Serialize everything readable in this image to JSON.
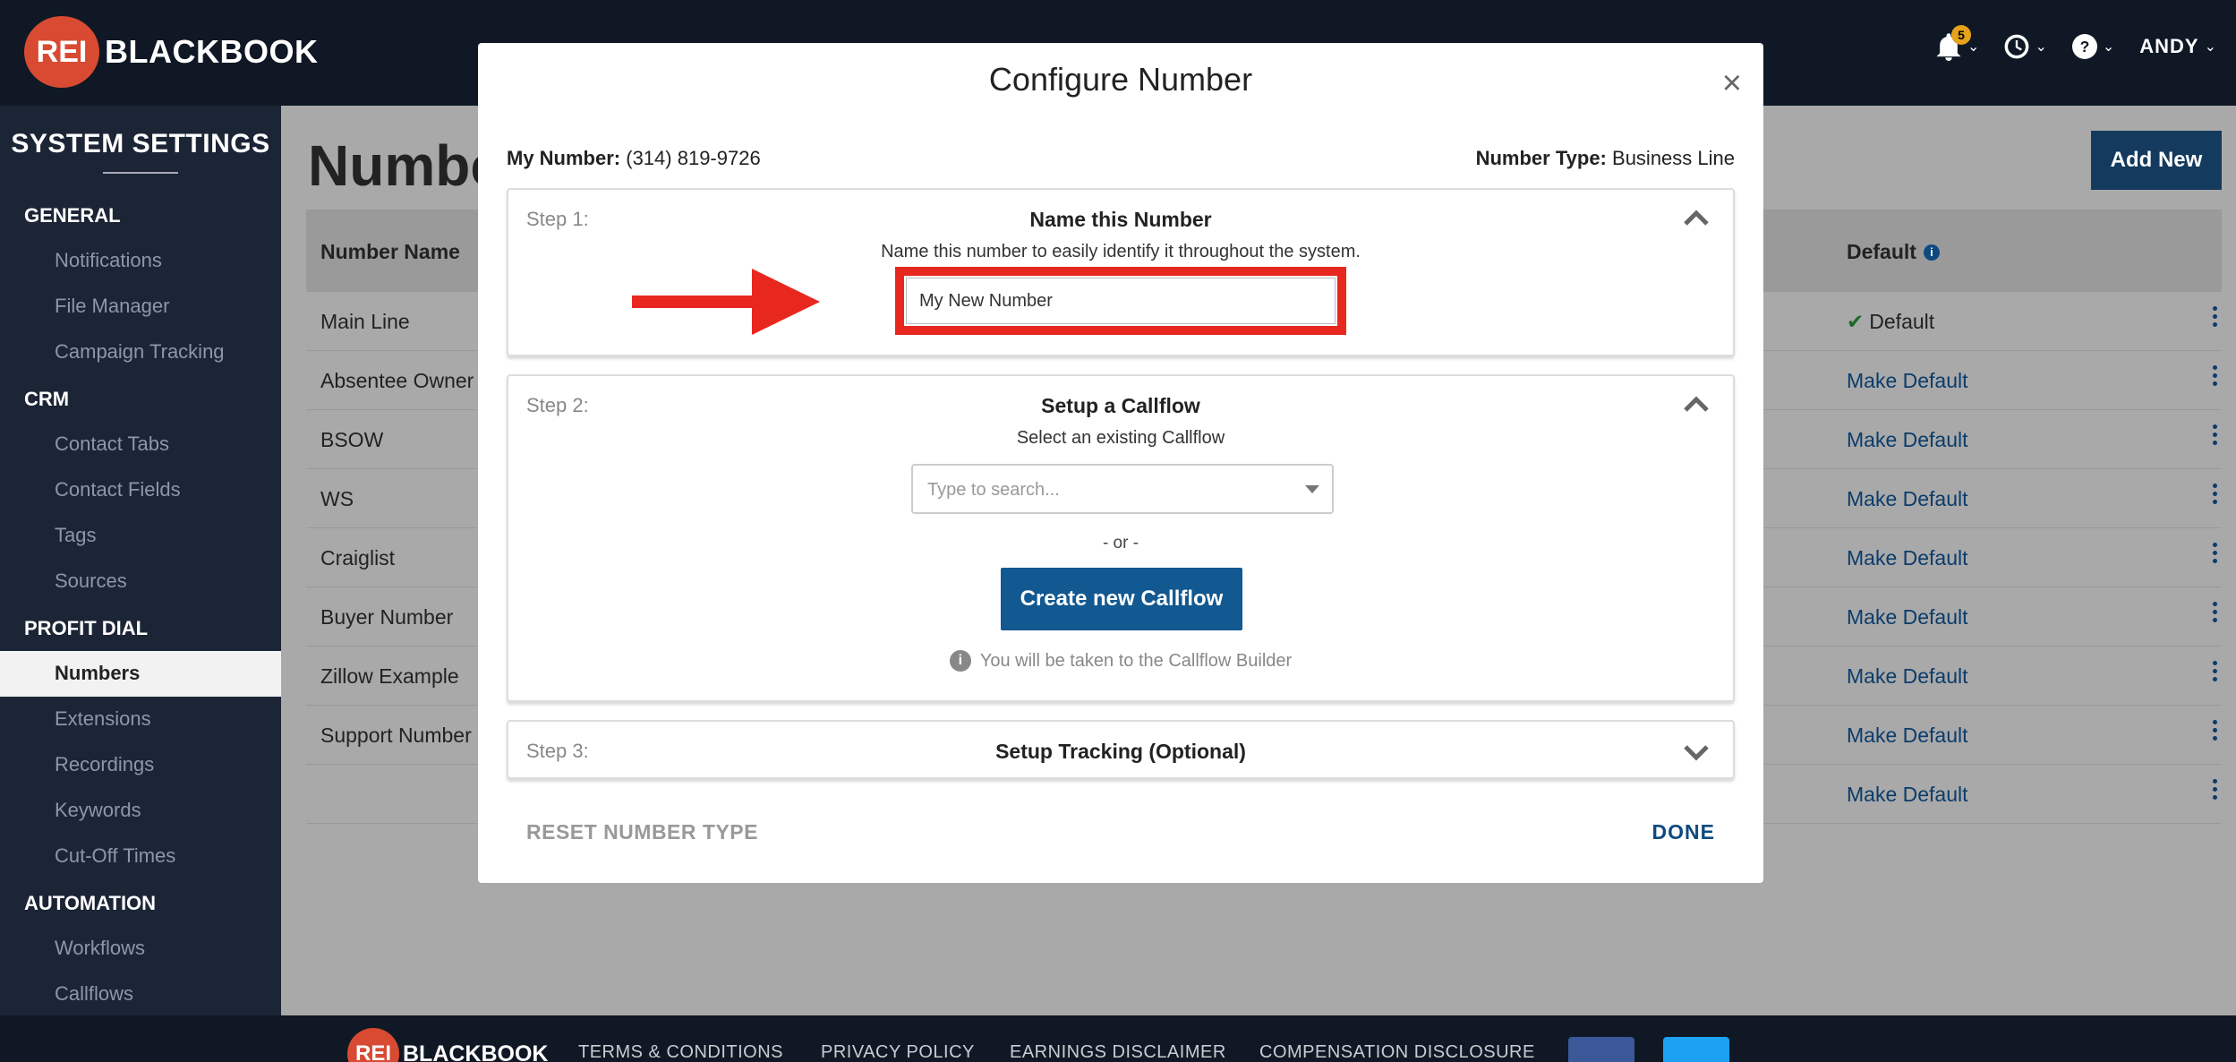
{
  "header": {
    "logo_badge": "REI",
    "logo_text": "BLACKBOOK",
    "notification_count": "5",
    "user_name": "ANDY",
    "icons": [
      "bell-icon",
      "clock-icon",
      "help-icon"
    ]
  },
  "sidebar": {
    "title": "SYSTEM SETTINGS",
    "sections": [
      {
        "label": "GENERAL",
        "items": [
          "Notifications",
          "File Manager",
          "Campaign Tracking"
        ]
      },
      {
        "label": "CRM",
        "items": [
          "Contact Tabs",
          "Contact Fields",
          "Tags",
          "Sources"
        ]
      },
      {
        "label": "PROFIT DIAL",
        "items": [
          "Numbers",
          "Extensions",
          "Recordings",
          "Keywords",
          "Cut-Off Times"
        ]
      },
      {
        "label": "AUTOMATION",
        "items": [
          "Workflows",
          "Callflows"
        ]
      }
    ],
    "active_item": "Numbers"
  },
  "main": {
    "title": "Numbe",
    "add_new_label": "Add New",
    "columns": {
      "name": "Number Name",
      "default": "Default"
    },
    "rows": [
      {
        "name": "Main Line",
        "default": "Default",
        "is_default": true
      },
      {
        "name": "Absentee Owner",
        "default": "Make Default",
        "is_default": false
      },
      {
        "name": "BSOW",
        "default": "Make Default",
        "is_default": false
      },
      {
        "name": "WS",
        "default": "Make Default",
        "is_default": false
      },
      {
        "name": "Craiglist",
        "default": "Make Default",
        "is_default": false
      },
      {
        "name": "Buyer Number",
        "default": "Make Default",
        "is_default": false
      },
      {
        "name": "Zillow Example",
        "default": "Make Default",
        "is_default": false
      },
      {
        "name": "Support Number",
        "default": "Make Default",
        "is_default": false
      },
      {
        "name": "",
        "default": "Make Default",
        "is_default": false
      }
    ]
  },
  "footer": {
    "logo_badge": "REI",
    "logo_text": "BLACKBOOK",
    "links": [
      "TERMS & CONDITIONS",
      "PRIVACY POLICY",
      "EARNINGS DISCLAIMER",
      "COMPENSATION DISCLOSURE"
    ],
    "social": [
      {
        "icon": "facebook-icon",
        "color": "#3b5998"
      },
      {
        "icon": "twitter-icon",
        "color": "#1da1f2"
      }
    ]
  },
  "modal": {
    "title": "Configure Number",
    "close": "×",
    "my_number_label": "My Number:",
    "my_number_value": "(314) 819-9726",
    "number_type_label": "Number Type:",
    "number_type_value": "Business Line",
    "step1": {
      "label": "Step 1:",
      "title": "Name this Number",
      "subtitle": "Name this number to easily identify it throughout the system.",
      "input_value": "My New Number"
    },
    "step2": {
      "label": "Step 2:",
      "title": "Setup a Callflow",
      "subtitle": "Select an existing Callflow",
      "search_placeholder": "Type to search...",
      "or_text": "- or -",
      "create_button": "Create new Callflow",
      "hint": "You will be taken to the Callflow Builder"
    },
    "step3": {
      "label": "Step 3:",
      "title": "Setup Tracking (Optional)"
    },
    "reset_label": "RESET NUMBER TYPE",
    "done_label": "DONE"
  },
  "colors": {
    "brand_red": "#d94a32",
    "annotation_red": "#e8281e",
    "primary_blue": "#125891"
  }
}
